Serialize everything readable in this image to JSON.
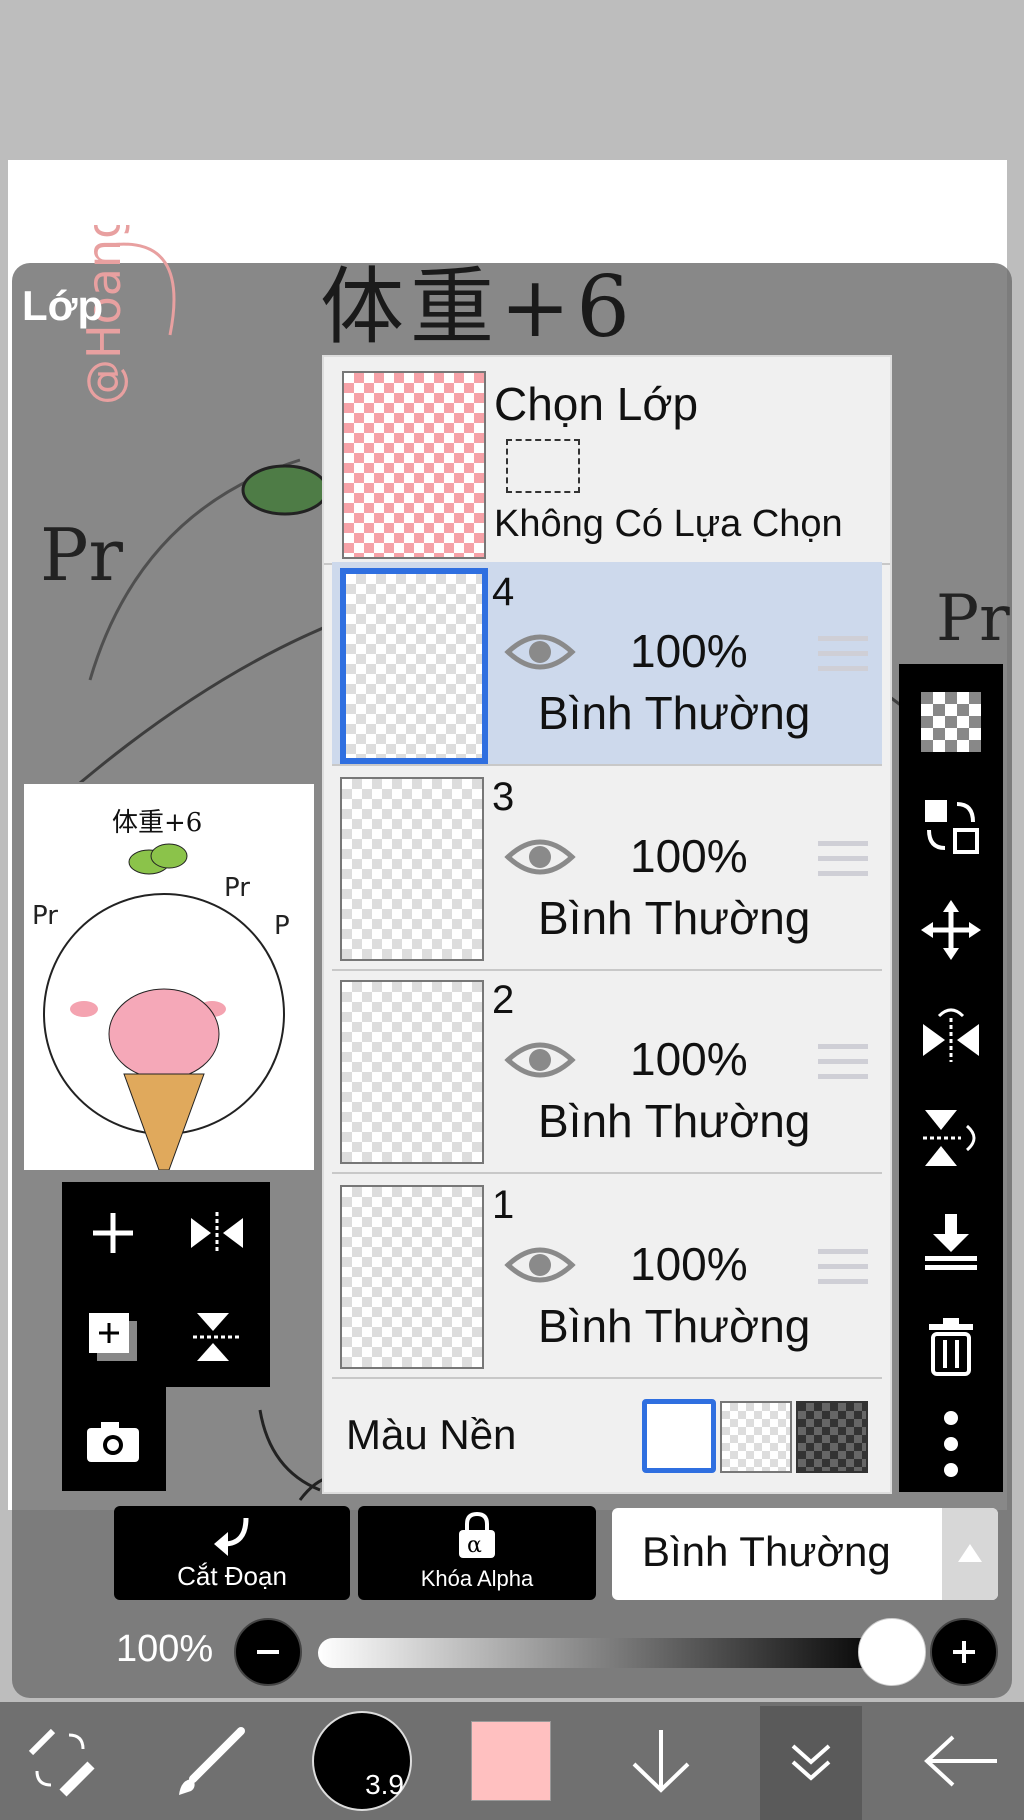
{
  "panel": {
    "title": "Lớp"
  },
  "artwork": {
    "title_text": "体重+6",
    "thumbnail_title": "体重+6"
  },
  "selection_layer": {
    "label": "Chọn Lớp",
    "status": "Không Có Lựa Chọn"
  },
  "layers": [
    {
      "number": "4",
      "opacity": "100%",
      "blend": "Bình Thường",
      "selected": true
    },
    {
      "number": "3",
      "opacity": "100%",
      "blend": "Bình Thường",
      "selected": false
    },
    {
      "number": "2",
      "opacity": "100%",
      "blend": "Bình Thường",
      "selected": false
    },
    {
      "number": "1",
      "opacity": "100%",
      "blend": "Bình Thường",
      "selected": false
    }
  ],
  "background": {
    "label": "Màu Nền"
  },
  "mode_buttons": {
    "clipping": "Cắt Đoạn",
    "alpha_lock": "Khóa Alpha"
  },
  "blend_select": {
    "value": "Bình Thường"
  },
  "opacity_control": {
    "value": "100%",
    "fraction": 1.0
  },
  "toolbar": {
    "brush_size": "3.9",
    "color": "#ffc0c0"
  },
  "colors": {
    "selected_row": "#cdd9ec",
    "accent": "#2f6fe0"
  }
}
